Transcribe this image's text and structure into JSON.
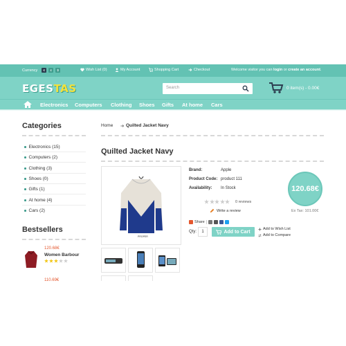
{
  "topbar": {
    "currency_label": "Currency",
    "currencies": [
      "€",
      "£",
      "$"
    ],
    "wishlist": "Wish List (0)",
    "my_account": "My Account",
    "shopping_cart": "Shopping Cart",
    "checkout": "Checkout",
    "welcome_prefix": "Welcome visitor you can ",
    "login": "login",
    "or": " or ",
    "create_account": "create an account",
    "welcome_suffix": "."
  },
  "header": {
    "logo_part1": "EGES",
    "logo_part2": "TAS",
    "search_placeholder": "Search",
    "cart_text": "0 item(s) - 0.00€"
  },
  "nav": {
    "items": [
      "Electronics",
      "Computers",
      "Clothing",
      "Shoes",
      "Gifts",
      "At home",
      "Cars"
    ]
  },
  "sidebar": {
    "categories_title": "Categories",
    "categories": [
      "Electronics (15)",
      "Computers (2)",
      "Clothing (3)",
      "Shoes (0)",
      "Gifts (1)",
      "At home (4)",
      "Cars (2)"
    ],
    "bestsellers_title": "Bestsellers",
    "bestsellers": [
      {
        "price": "120.68€",
        "name": "Women Barbour",
        "rating": 3
      },
      {
        "price": "110.69€"
      }
    ]
  },
  "breadcrumb": {
    "home": "Home",
    "arrow": "➔",
    "current": "Quilted Jacket Navy"
  },
  "product": {
    "title": "Quilted Jacket Navy",
    "brand_label": "Brand:",
    "brand": "Apple",
    "code_label": "Product Code:",
    "code": "product 111",
    "availability_label": "Availability:",
    "availability": "In Stock",
    "price": "120.68€",
    "ex_tax": "Ex Tax: 101.00€",
    "reviews": "0 reviews",
    "rating": 0,
    "write_review": "Write a review",
    "share": "Share",
    "qty_label": "Qty:",
    "qty": "1",
    "add_to_cart": "Add to Cart",
    "add_wishlist": "Add to Wish List",
    "add_compare": "Add to Compare",
    "image_caption": "PROPER"
  },
  "colors": {
    "topbar": "#63c2b3",
    "header": "#7fd3c6",
    "accent": "#3f9c8d",
    "price": "#e4572e",
    "star": "#f1c40f",
    "logo_yellow": "#f5e23a"
  }
}
